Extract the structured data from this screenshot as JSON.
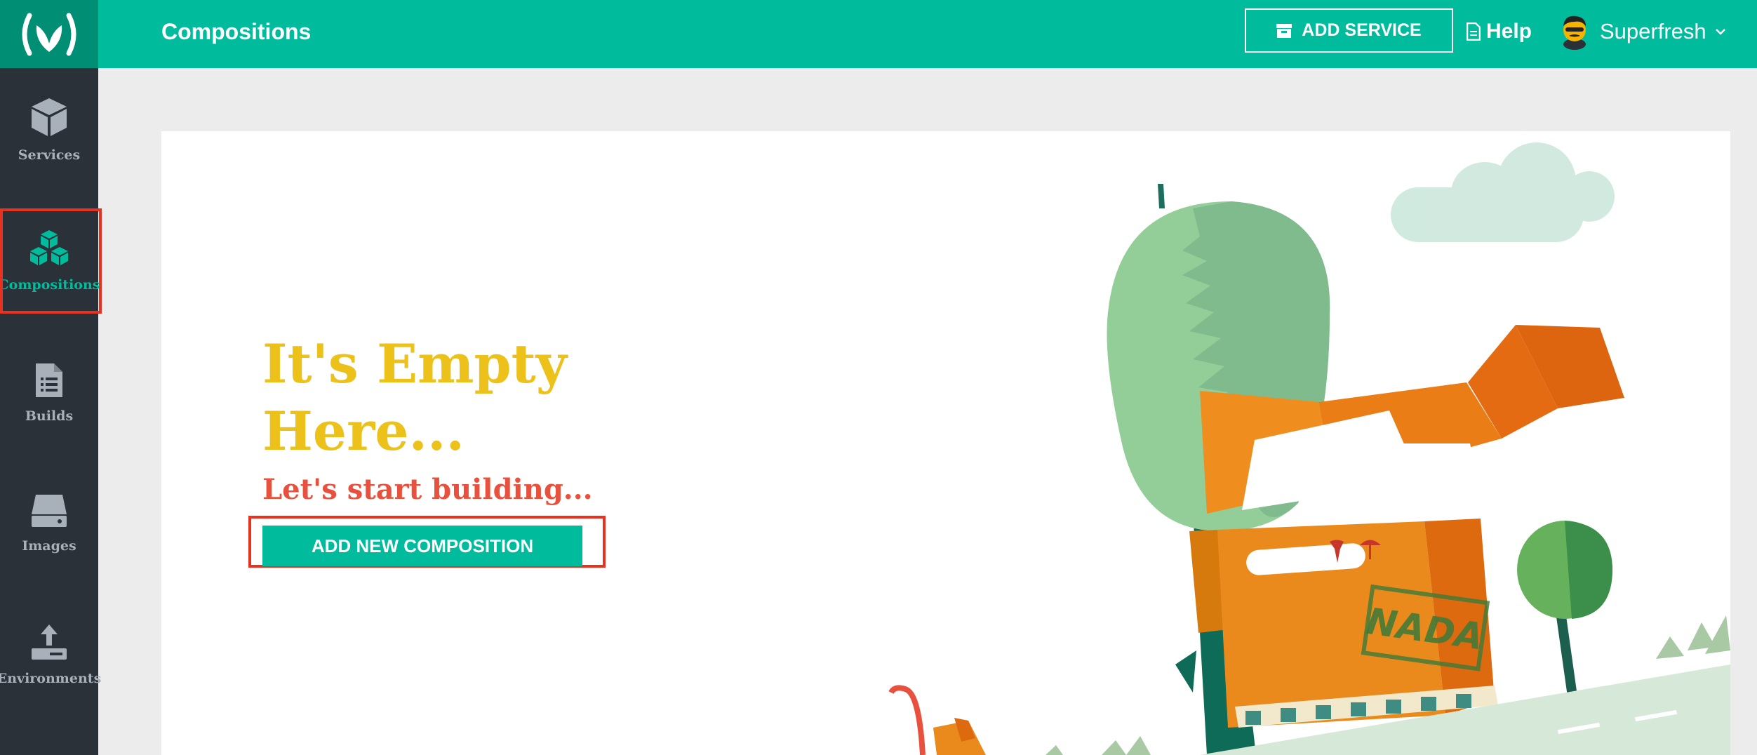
{
  "header": {
    "title": "Compositions",
    "add_service_label": "ADD SERVICE",
    "help_label": "Help",
    "user_name": "Superfresh"
  },
  "sidebar": {
    "items": [
      {
        "label": "Services",
        "icon": "box-icon",
        "active": false
      },
      {
        "label": "Compositions",
        "icon": "cubes-icon",
        "active": true
      },
      {
        "label": "Builds",
        "icon": "document-icon",
        "active": false
      },
      {
        "label": "Images",
        "icon": "drive-icon",
        "active": false
      },
      {
        "label": "Environments",
        "icon": "upload-icon",
        "active": false
      }
    ]
  },
  "empty_state": {
    "headline": "It's Empty Here...",
    "subline": "Let's start building...",
    "button_label": "ADD NEW COMPOSITION",
    "stamp_text": "NADA"
  },
  "colors": {
    "accent": "#00bc9c",
    "logo_bg": "#008f74",
    "sidebar_bg": "#2b3139",
    "headline": "#ecc21a",
    "subline": "#e8513d",
    "highlight": "#e8321f"
  }
}
